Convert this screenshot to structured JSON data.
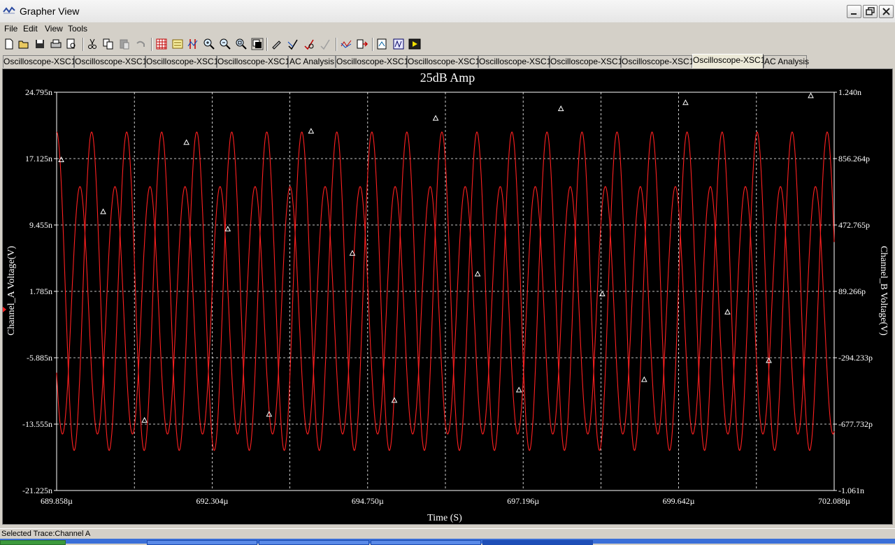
{
  "window": {
    "title": "Grapher View"
  },
  "menu": [
    "File",
    "Edit",
    "View",
    "Tools"
  ],
  "toolbar": {
    "icons": [
      "new-icon",
      "open-icon",
      "save-icon",
      "print-icon",
      "print-preview-icon",
      "cut-icon",
      "copy-icon",
      "paste-icon",
      "undo-icon",
      "grid-icon",
      "legend-icon",
      "cursors-icon",
      "zoom-in-icon",
      "zoom-out-icon",
      "zoom-full-icon",
      "reverse-colors-icon",
      "properties-icon",
      "overlay-icon",
      "select-marks-icon",
      "export-icon",
      "transfer-icon",
      "export-excel-icon",
      "export-mathcad-icon",
      "export-labview-icon"
    ]
  },
  "tabs": [
    {
      "label": "Oscilloscope-XSC1",
      "active": false
    },
    {
      "label": "Oscilloscope-XSC1",
      "active": false
    },
    {
      "label": "Oscilloscope-XSC1",
      "active": false
    },
    {
      "label": "Oscilloscope-XSC1",
      "active": false
    },
    {
      "label": "AC Analysis",
      "active": false
    },
    {
      "label": "Oscilloscope-XSC1",
      "active": false
    },
    {
      "label": "Oscilloscope-XSC1",
      "active": false
    },
    {
      "label": "Oscilloscope-XSC1",
      "active": false
    },
    {
      "label": "Oscilloscope-XSC1",
      "active": false
    },
    {
      "label": "Oscilloscope-XSC1",
      "active": false
    },
    {
      "label": "Oscilloscope-XSC1",
      "active": true
    },
    {
      "label": "AC Analysis",
      "active": false
    }
  ],
  "chart_data": {
    "type": "line",
    "title": "25dB Amp",
    "xlabel": "Time (S)",
    "ylabel_left": "Channel_A Voltage(V)",
    "ylabel_right": "Channel_B Voltage(V)",
    "x_ticks": [
      "689.858µ",
      "692.304µ",
      "694.750µ",
      "697.196µ",
      "699.642µ",
      "702.088µ"
    ],
    "y_left_ticks": [
      "24.795n",
      "17.125n",
      "9.455n",
      "1.785n",
      "-5.885n",
      "-13.555n",
      "-21.225n"
    ],
    "y_right_ticks": [
      "1.240n",
      "856.264p",
      "472.765p",
      "89.266p",
      "-294.233p",
      "-677.732p",
      "-1.061n"
    ],
    "xlim": [
      689.858,
      702.088
    ],
    "ylim_left": [
      -21.225,
      24.795
    ],
    "ylim_right": [
      -1.061,
      1.24
    ],
    "grid": true,
    "colors": {
      "background": "#000000",
      "grid": "#ffffff",
      "trace_a": "#ff2020",
      "trace_b": "#ff2020",
      "markers": "#ffffff"
    },
    "series": [
      {
        "name": "Channel A",
        "amplitude_n": 18.4,
        "offset_n": 1.8,
        "periods_visible": 22.2,
        "phase": 0.0
      },
      {
        "name": "Channel B",
        "amplitude_p": 715,
        "offset_p": -20,
        "periods_visible": 22.2,
        "phase": 2.1
      }
    ],
    "markers": [
      {
        "x": 689.93,
        "y": 17.0
      },
      {
        "x": 690.59,
        "y": 11.0
      },
      {
        "x": 691.24,
        "y": -13.1
      },
      {
        "x": 691.9,
        "y": 19.0
      },
      {
        "x": 692.55,
        "y": 9.0
      },
      {
        "x": 693.2,
        "y": -12.4
      },
      {
        "x": 693.86,
        "y": 20.3
      },
      {
        "x": 694.51,
        "y": 6.2
      },
      {
        "x": 695.17,
        "y": -10.8
      },
      {
        "x": 695.82,
        "y": 21.8
      },
      {
        "x": 696.48,
        "y": 3.8
      },
      {
        "x": 697.13,
        "y": -9.6
      },
      {
        "x": 697.79,
        "y": 22.9
      },
      {
        "x": 698.44,
        "y": 1.5
      },
      {
        "x": 699.1,
        "y": -8.4
      },
      {
        "x": 699.75,
        "y": 23.6
      },
      {
        "x": 700.41,
        "y": -0.6
      },
      {
        "x": 701.06,
        "y": -6.2
      },
      {
        "x": 701.72,
        "y": 24.4
      }
    ]
  },
  "status": {
    "selected_trace": "Selected Trace:Channel A"
  }
}
